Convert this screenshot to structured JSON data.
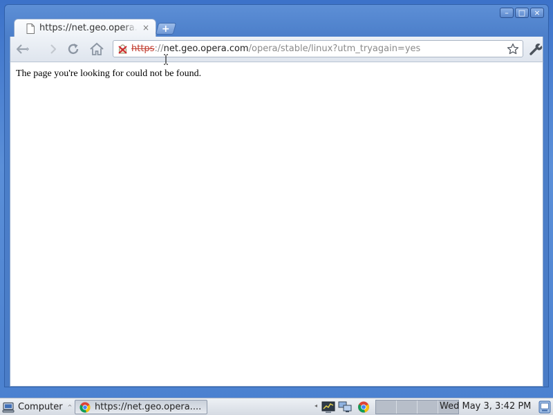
{
  "browser": {
    "tab": {
      "title": "https://net.geo.opera.com/opera/stable/linux?utm_tryagain=yes",
      "close_glyph": "×",
      "favicon": "page-icon"
    },
    "new_tab_glyph": "+",
    "window_controls": {
      "minimize_glyph": "–",
      "maximize_glyph": "□",
      "close_glyph": "×"
    },
    "toolbar": {
      "back_icon": "back-arrow-icon",
      "forward_icon": "forward-arrow-icon",
      "reload_icon": "reload-icon",
      "home_icon": "home-icon",
      "wrench_icon": "wrench-icon"
    },
    "omnibox": {
      "security_icon": "broken-lock-icon",
      "scheme": "https",
      "separator": "://",
      "host": "net.geo.opera.com",
      "path": "/opera/stable/linux?utm_tryagain=yes",
      "bookmark_icon": "star-icon"
    }
  },
  "page": {
    "message": "The page you're looking for could not be found."
  },
  "taskbar": {
    "menu_label": "Computer",
    "menu_arrow": "^",
    "task_label": "https://net.geo.opera....",
    "tray_arrow": "◂",
    "clock": "Wed May  3,  3:42 PM",
    "workspaces": 4
  },
  "colors": {
    "desktop_blue": "#4a80cf",
    "scheme_red": "#c0392b",
    "url_gray": "#8a8a8a"
  }
}
